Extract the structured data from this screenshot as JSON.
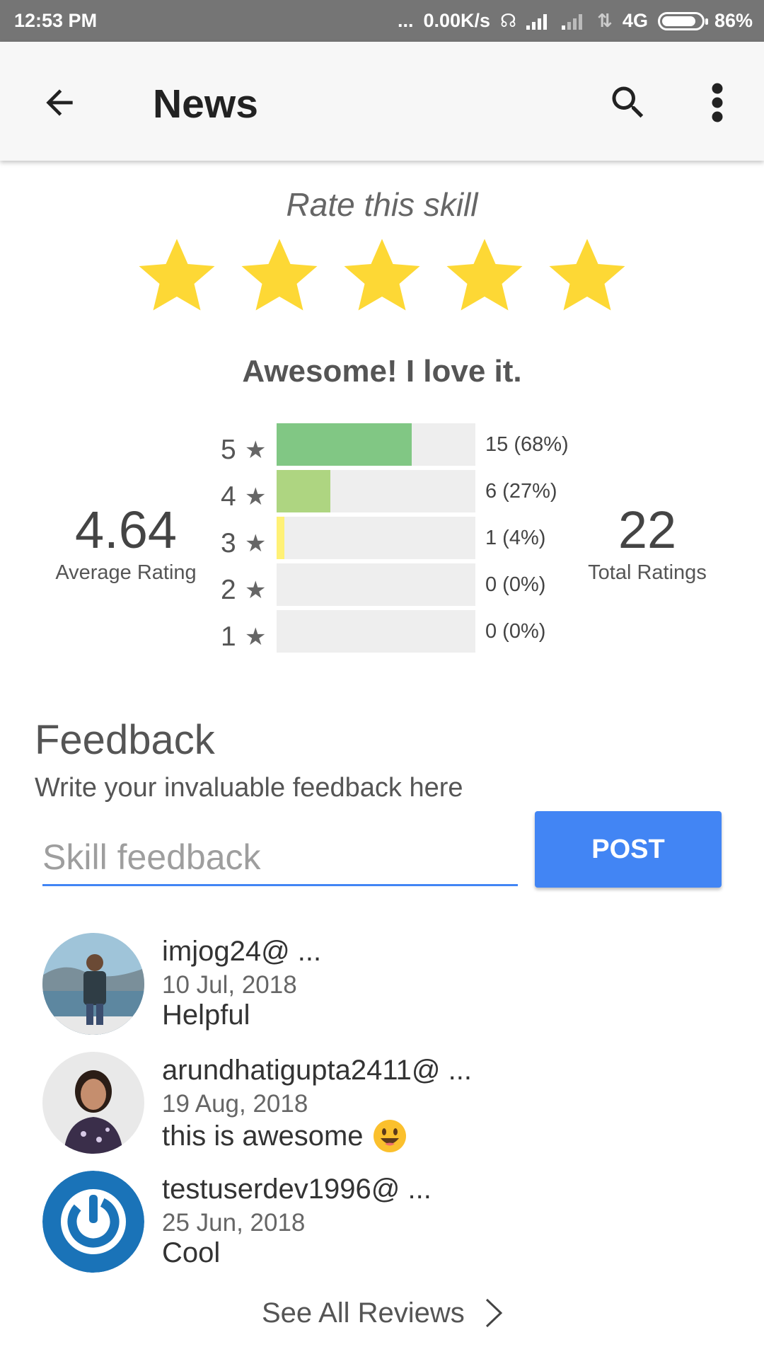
{
  "status_bar": {
    "time": "12:53 PM",
    "dots": "...",
    "speed": "0.00K/s",
    "network": "4G",
    "battery": "86%"
  },
  "appbar": {
    "title": "News",
    "icons": [
      "back-arrow-icon",
      "search-icon",
      "more-vert-icon"
    ]
  },
  "rating_prompt": {
    "title": "Rate this skill",
    "selected_stars": 5,
    "max_stars": 5,
    "caption": "Awesome! I love it.",
    "star_color": "#fdd835"
  },
  "summary": {
    "average_value": "4.64",
    "average_label": "Average Rating",
    "total_value": "22",
    "total_label": "Total Ratings",
    "distribution": [
      {
        "stars": "5",
        "count_text": "15 (68%)",
        "fraction": 0.68,
        "color": "#81c784"
      },
      {
        "stars": "4",
        "count_text": "6 (27%)",
        "fraction": 0.27,
        "color": "#aed581"
      },
      {
        "stars": "3",
        "count_text": "1 (4%)",
        "fraction": 0.04,
        "color": "#fff176"
      },
      {
        "stars": "2",
        "count_text": "0 (0%)",
        "fraction": 0,
        "color": "#ffb74d"
      },
      {
        "stars": "1",
        "count_text": "0 (0%)",
        "fraction": 0,
        "color": "#e57373"
      }
    ]
  },
  "feedback": {
    "title": "Feedback",
    "subtitle": "Write your invaluable feedback here",
    "placeholder": "Skill feedback",
    "value": "",
    "post_label": "POST",
    "accent": "#4285f4"
  },
  "reviews": [
    {
      "user": "imjog24@ ...",
      "date": "10 Jul, 2018",
      "text": "Helpful"
    },
    {
      "user": "arundhatigupta2411@ ...",
      "date": "19 Aug, 2018",
      "text": "this is awesome",
      "emoji": "smiling-face-emoji"
    },
    {
      "user": "testuserdev1996@ ...",
      "date": "25 Jun, 2018",
      "text": "Cool"
    }
  ],
  "see_all": "See All Reviews"
}
